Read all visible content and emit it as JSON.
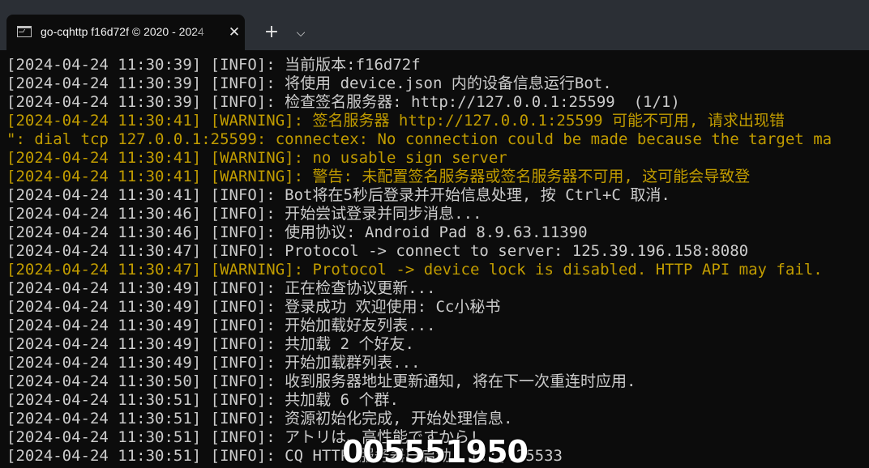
{
  "tab": {
    "icon": "terminal-icon",
    "title": "go-cqhttp f16d72f © 2020 - 2024"
  },
  "controls": {
    "close_glyph": "✕",
    "new_tab_glyph": "+",
    "dropdown_glyph": "⌵"
  },
  "colors": {
    "info": "#cccccc",
    "warning": "#c19c00",
    "background": "#0c0c0c",
    "titlebar": "#2b2f35"
  },
  "lines": [
    {
      "level": "info",
      "text": "[2024-04-24 11:30:39] [INFO]: 当前版本:f16d72f"
    },
    {
      "level": "info",
      "text": "[2024-04-24 11:30:39] [INFO]: 将使用 device.json 内的设备信息运行Bot."
    },
    {
      "level": "info",
      "text": "[2024-04-24 11:30:39] [INFO]: 检查签名服务器: http://127.0.0.1:25599  (1/1)"
    },
    {
      "level": "warning",
      "text": "[2024-04-24 11:30:41] [WARNING]: 签名服务器 http://127.0.0.1:25599 可能不可用, 请求出现错"
    },
    {
      "level": "warning",
      "text": "\": dial tcp 127.0.0.1:25599: connectex: No connection could be made because the target ma"
    },
    {
      "level": "warning",
      "text": "[2024-04-24 11:30:41] [WARNING]: no usable sign server"
    },
    {
      "level": "warning",
      "text": "[2024-04-24 11:30:41] [WARNING]: 警告: 未配置签名服务器或签名服务器不可用, 这可能会导致登"
    },
    {
      "level": "info",
      "text": "[2024-04-24 11:30:41] [INFO]: Bot将在5秒后登录并开始信息处理, 按 Ctrl+C 取消."
    },
    {
      "level": "info",
      "text": "[2024-04-24 11:30:46] [INFO]: 开始尝试登录并同步消息..."
    },
    {
      "level": "info",
      "text": "[2024-04-24 11:30:46] [INFO]: 使用协议: Android Pad 8.9.63.11390"
    },
    {
      "level": "info",
      "text": "[2024-04-24 11:30:47] [INFO]: Protocol -> connect to server: 125.39.196.158:8080"
    },
    {
      "level": "warning",
      "text": "[2024-04-24 11:30:47] [WARNING]: Protocol -> device lock is disabled. HTTP API may fail."
    },
    {
      "level": "info",
      "text": "[2024-04-24 11:30:49] [INFO]: 正在检查协议更新..."
    },
    {
      "level": "info",
      "text": "[2024-04-24 11:30:49] [INFO]: 登录成功 欢迎使用: Cc小秘书"
    },
    {
      "level": "info",
      "text": "[2024-04-24 11:30:49] [INFO]: 开始加载好友列表..."
    },
    {
      "level": "info",
      "text": "[2024-04-24 11:30:49] [INFO]: 共加载 2 个好友."
    },
    {
      "level": "info",
      "text": "[2024-04-24 11:30:49] [INFO]: 开始加载群列表..."
    },
    {
      "level": "info",
      "text": "[2024-04-24 11:30:50] [INFO]: 收到服务器地址更新通知, 将在下一次重连时应用."
    },
    {
      "level": "info",
      "text": "[2024-04-24 11:30:51] [INFO]: 共加载 6 个群."
    },
    {
      "level": "info",
      "text": "[2024-04-24 11:30:51] [INFO]: 资源初始化完成, 开始处理信息."
    },
    {
      "level": "info",
      "text": "[2024-04-24 11:30:51] [INFO]: アトリは、高性能ですから!"
    },
    {
      "level": "info",
      "text": "[2024-04-24 11:30:51] [INFO]: CQ HTTP 服务器已启动: [::]:25533"
    }
  ],
  "watermark": "005551950"
}
